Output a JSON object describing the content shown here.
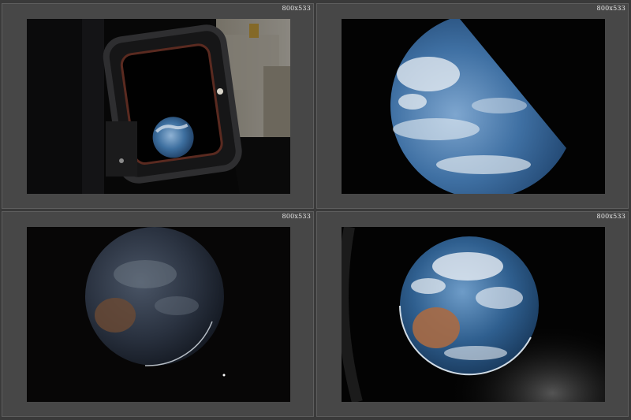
{
  "sheet": {
    "thumbnails": [
      {
        "label": "800x533",
        "subject": "earth through spacecraft window"
      },
      {
        "label": "800x533",
        "subject": "earth crescent over pacific"
      },
      {
        "label": "800x533",
        "subject": "dim earth with australia"
      },
      {
        "label": "800x533",
        "subject": "bright earth with australia"
      }
    ]
  },
  "colors": {
    "background": "#3a3a3a",
    "frame": "#474747",
    "ocean": "#2f5f8f",
    "cloud": "#e9eef4",
    "australia": "#a86a44",
    "space": "#030303"
  }
}
